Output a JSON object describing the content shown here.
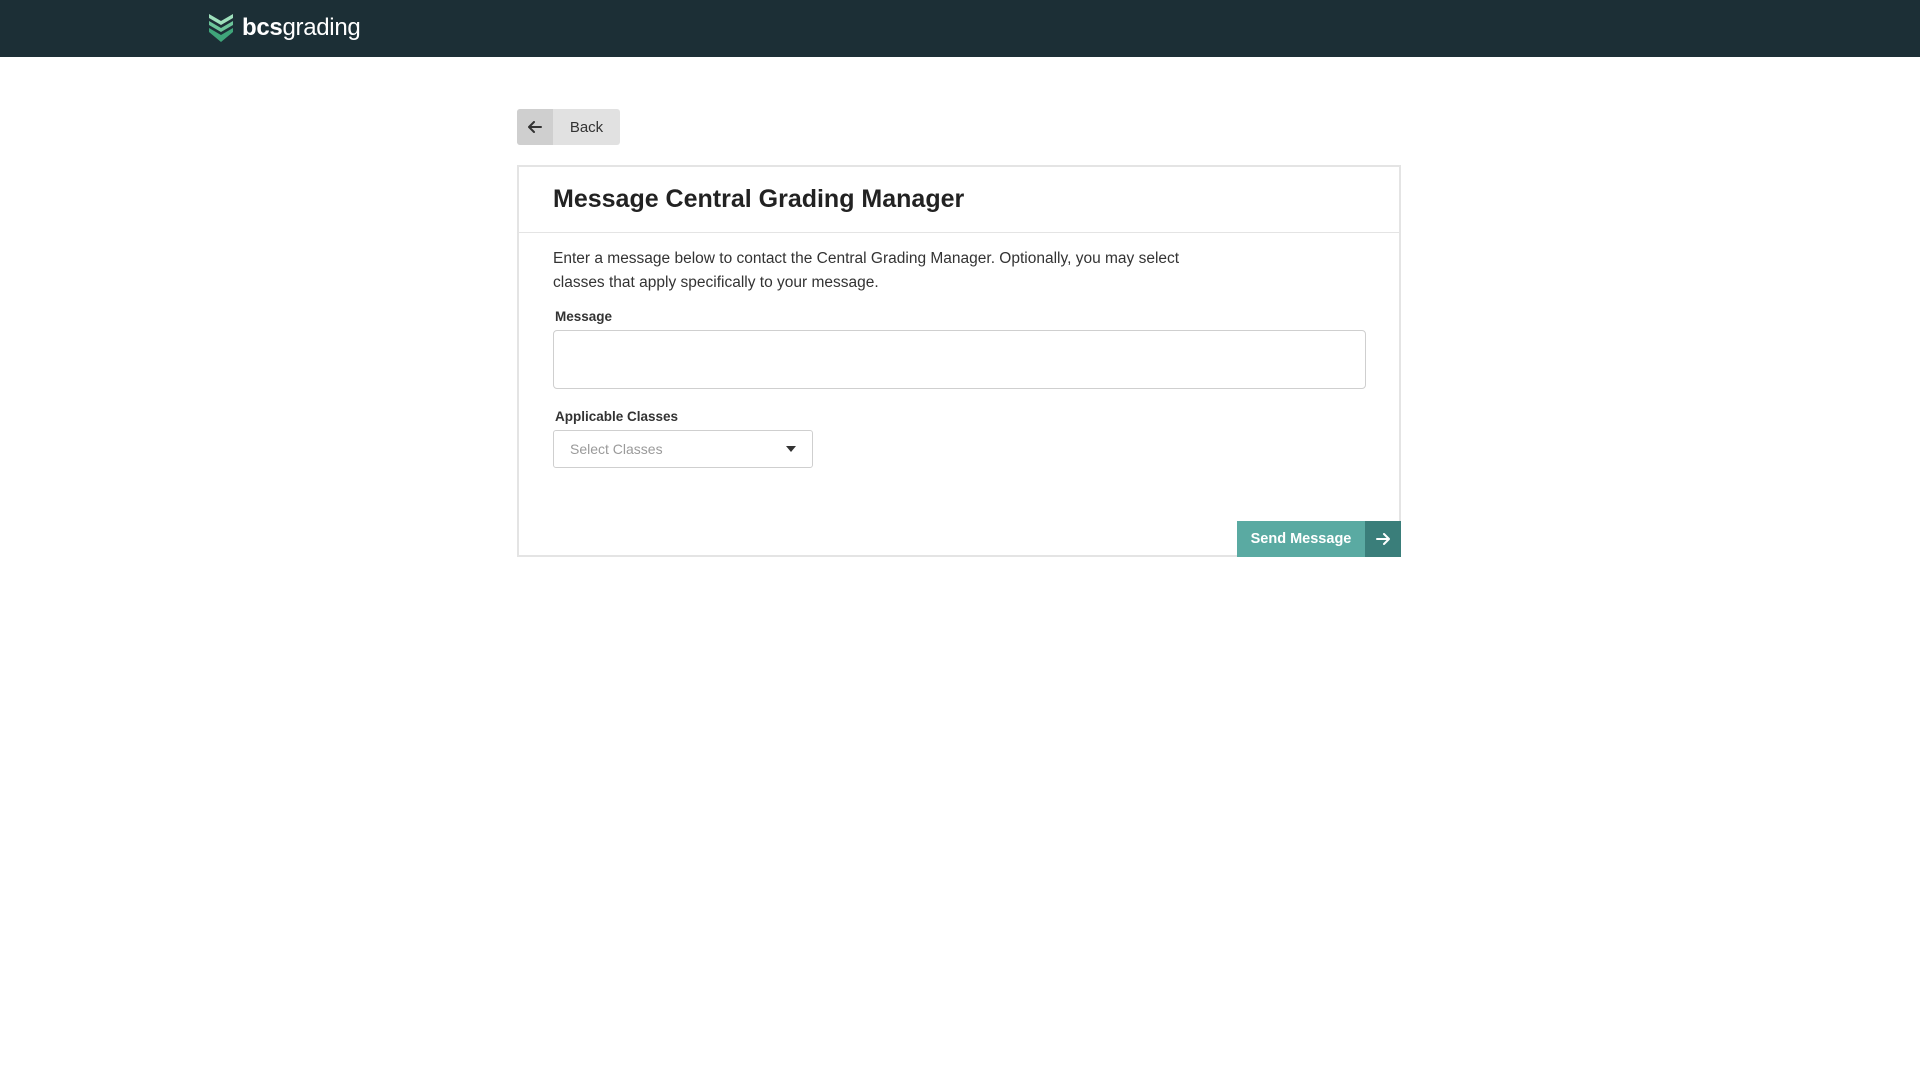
{
  "header": {
    "logo_bold": "bcs",
    "logo_regular": "grading",
    "logo_icon": "layered-chevron-logo-icon"
  },
  "back_button": {
    "label": "Back",
    "icon": "arrow-left-icon"
  },
  "card": {
    "title": "Message Central Grading Manager",
    "intro": "Enter a message below to contact the Central Grading Manager. Optionally, you may select classes that apply specifically to your message."
  },
  "form": {
    "message_label": "Message",
    "message_value": "",
    "classes_label": "Applicable Classes",
    "classes_placeholder": "Select Classes",
    "classes_icon": "caret-down-icon"
  },
  "send_button": {
    "label": "Send Message",
    "icon": "arrow-right-icon"
  },
  "colors": {
    "header_bg": "#1c2f36",
    "accent": "#5aaaa2",
    "accent_dark": "#3a7e7a",
    "logo_green": "#7fcfa0"
  }
}
